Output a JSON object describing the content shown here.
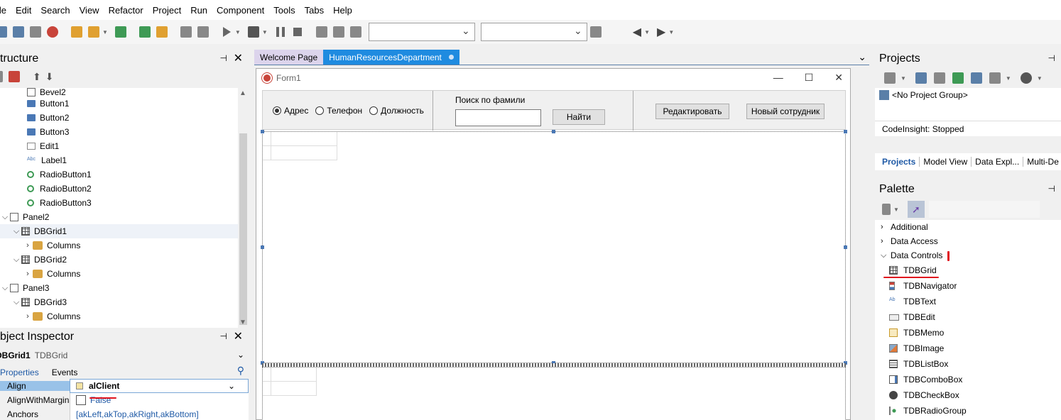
{
  "menu": [
    "ile",
    "Edit",
    "Search",
    "View",
    "Refactor",
    "Project",
    "Run",
    "Component",
    "Tools",
    "Tabs",
    "Help"
  ],
  "structure": {
    "title": "tructure",
    "items": [
      {
        "label": "Bevel2",
        "icon": "bevel-icon",
        "indent": 38
      },
      {
        "label": "Button1",
        "icon": "button-icon",
        "indent": 38
      },
      {
        "label": "Button2",
        "icon": "button-icon",
        "indent": 38
      },
      {
        "label": "Button3",
        "icon": "button-icon",
        "indent": 38
      },
      {
        "label": "Edit1",
        "icon": "edit-icon",
        "indent": 38
      },
      {
        "label": "Label1",
        "icon": "label-icon",
        "indent": 38
      },
      {
        "label": "RadioButton1",
        "icon": "radio-icon",
        "indent": 38
      },
      {
        "label": "RadioButton2",
        "icon": "radio-icon",
        "indent": 38
      },
      {
        "label": "RadioButton3",
        "icon": "radio-icon",
        "indent": 38
      },
      {
        "label": "Panel2",
        "icon": "panel-icon",
        "indent": 6,
        "expander": "v"
      },
      {
        "label": "DBGrid1",
        "icon": "grid-icon",
        "indent": 22,
        "expander": "v",
        "selected": true
      },
      {
        "label": "Columns",
        "icon": "columns-icon",
        "indent": 38,
        "expander": ">"
      },
      {
        "label": "DBGrid2",
        "icon": "grid-icon",
        "indent": 22,
        "expander": "v"
      },
      {
        "label": "Columns",
        "icon": "columns-icon",
        "indent": 38,
        "expander": ">"
      },
      {
        "label": "Panel3",
        "icon": "panel-icon",
        "indent": 6,
        "expander": "v"
      },
      {
        "label": "DBGrid3",
        "icon": "grid-icon",
        "indent": 22,
        "expander": "v"
      },
      {
        "label": "Columns",
        "icon": "columns-icon",
        "indent": 38,
        "expander": ">"
      }
    ]
  },
  "inspector": {
    "title": "bject Inspector",
    "selected_name": "DBGrid1",
    "selected_type": "TDBGrid",
    "tab_properties": "Properties",
    "tab_events": "Events",
    "props": [
      {
        "name": "Align",
        "value": "alClient",
        "selected": true
      },
      {
        "name": "AlignWithMargins",
        "value": "False"
      },
      {
        "name": "Anchors",
        "value": "[akLeft,akTop,akRight,akBottom]"
      }
    ]
  },
  "tabs": {
    "welcome": "Welcome Page",
    "active": "HumanResourcesDepartment"
  },
  "form": {
    "title": "Form1",
    "radio1": "Адрес",
    "radio2": "Телефон",
    "radio3": "Должность",
    "search_label": "Поиск по фамили",
    "find_button": "Найти",
    "edit_button": "Редактировать",
    "new_button": "Новый сотрудник"
  },
  "projects": {
    "title": "Projects",
    "group": "<No Project Group>",
    "codeinsight": "CodeInsight: Stopped",
    "tabs": [
      "Projects",
      "Model View",
      "Data Expl...",
      "Multi-De"
    ]
  },
  "palette": {
    "title": "Palette",
    "categories": [
      "Additional",
      "Data Access",
      "Data Controls"
    ],
    "items": [
      {
        "label": "TDBGrid",
        "icon": "dbgrid-icon"
      },
      {
        "label": "TDBNavigator",
        "icon": "dbnavigator-icon"
      },
      {
        "label": "TDBText",
        "icon": "dbtext-icon"
      },
      {
        "label": "TDBEdit",
        "icon": "dbedit-icon"
      },
      {
        "label": "TDBMemo",
        "icon": "dbmemo-icon"
      },
      {
        "label": "TDBImage",
        "icon": "dbimage-icon"
      },
      {
        "label": "TDBListBox",
        "icon": "dblistbox-icon"
      },
      {
        "label": "TDBComboBox",
        "icon": "dbcombobox-icon"
      },
      {
        "label": "TDBCheckBox",
        "icon": "dbcheckbox-icon"
      },
      {
        "label": "TDBRadioGroup",
        "icon": "dbradiogroup-icon"
      }
    ]
  },
  "colors": {
    "accent": "#1f8be0",
    "selection": "#99c2e8",
    "annotation_red": "#e0141e"
  }
}
